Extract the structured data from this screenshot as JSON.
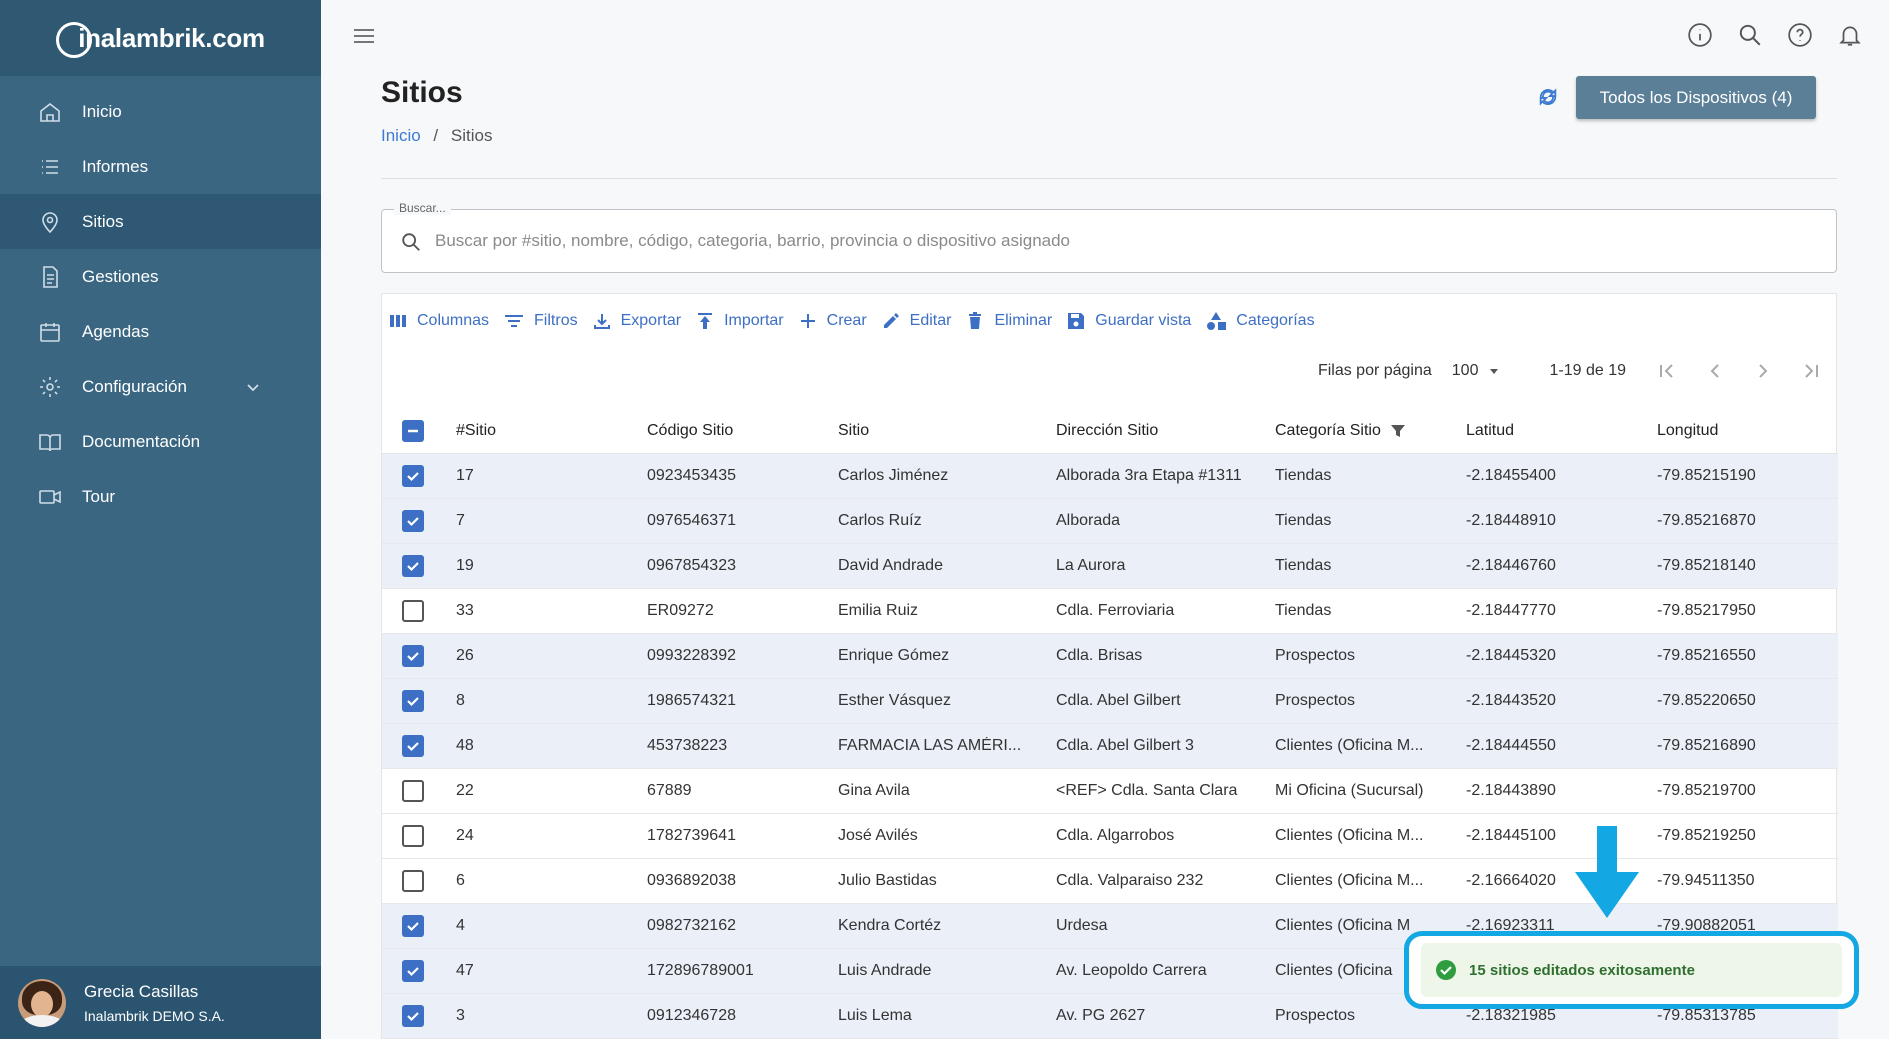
{
  "app": {
    "logo_text": "alambrik.com",
    "logo_prefix": "in"
  },
  "sidebar": {
    "items": [
      {
        "label": "Inicio",
        "icon": "home-icon"
      },
      {
        "label": "Informes",
        "icon": "list-icon"
      },
      {
        "label": "Sitios",
        "icon": "location-pin-icon",
        "active": true
      },
      {
        "label": "Gestiones",
        "icon": "document-icon"
      },
      {
        "label": "Agendas",
        "icon": "calendar-icon"
      },
      {
        "label": "Configuración",
        "icon": "gear-icon"
      },
      {
        "label": "Documentación",
        "icon": "book-icon"
      },
      {
        "label": "Tour",
        "icon": "video-camera-icon"
      }
    ],
    "user": {
      "name": "Grecia Casillas",
      "org": "Inalambrik DEMO S.A."
    }
  },
  "header": {
    "title": "Sitios",
    "breadcrumb": {
      "home": "Inicio",
      "sep": "/",
      "current": "Sitios"
    },
    "devices_button": "Todos los Dispositivos (4)"
  },
  "search": {
    "label": "Buscar...",
    "placeholder": "Buscar por #sitio, nombre, código, categoria, barrio, provincia o dispositivo asignado",
    "value": ""
  },
  "toolbar": {
    "columns": "Columnas",
    "filters": "Filtros",
    "export": "Exportar",
    "import": "Importar",
    "create": "Crear",
    "edit": "Editar",
    "delete": "Eliminar",
    "save_view": "Guardar vista",
    "categories": "Categorías"
  },
  "pager": {
    "rows_label": "Filas por página",
    "rows_value": "100",
    "range": "1-19 de 19"
  },
  "table": {
    "headers": [
      "#Sitio",
      "Código Sitio",
      "Sitio",
      "Dirección Sitio",
      "Categoría Sitio",
      "Latitud",
      "Longitud"
    ],
    "rows": [
      {
        "checked": true,
        "cells": [
          "17",
          "0923453435",
          "Carlos Jiménez",
          "Alborada 3ra Etapa #1311",
          "Tiendas",
          "-2.18455400",
          "-79.85215190"
        ]
      },
      {
        "checked": true,
        "cells": [
          "7",
          "0976546371",
          "Carlos Ruíz",
          "Alborada",
          "Tiendas",
          "-2.18448910",
          "-79.85216870"
        ]
      },
      {
        "checked": true,
        "cells": [
          "19",
          "0967854323",
          "David Andrade",
          "La Aurora",
          "Tiendas",
          "-2.18446760",
          "-79.85218140"
        ]
      },
      {
        "checked": false,
        "cells": [
          "33",
          "ER09272",
          "Emilia Ruiz",
          "Cdla. Ferroviaria",
          "Tiendas",
          "-2.18447770",
          "-79.85217950"
        ]
      },
      {
        "checked": true,
        "cells": [
          "26",
          "0993228392",
          "Enrique Gómez",
          "Cdla. Brisas",
          "Prospectos",
          "-2.18445320",
          "-79.85216550"
        ]
      },
      {
        "checked": true,
        "cells": [
          "8",
          "1986574321",
          "Esther Vásquez",
          "Cdla. Abel Gilbert",
          "Prospectos",
          "-2.18443520",
          "-79.85220650"
        ]
      },
      {
        "checked": true,
        "cells": [
          "48",
          "453738223",
          "FARMACIA LAS AMÉRI...",
          "Cdla. Abel Gilbert 3",
          "Clientes (Oficina M...",
          "-2.18444550",
          "-79.85216890"
        ]
      },
      {
        "checked": false,
        "cells": [
          "22",
          "67889",
          "Gina Avila",
          "<REF> Cdla. Santa Clara",
          "Mi Oficina (Sucursal)",
          "-2.18443890",
          "-79.85219700"
        ]
      },
      {
        "checked": false,
        "cells": [
          "24",
          "1782739641",
          "José Avilés",
          "Cdla. Algarrobos",
          "Clientes (Oficina M...",
          "-2.18445100",
          "-79.85219250"
        ]
      },
      {
        "checked": false,
        "cells": [
          "6",
          "0936892038",
          "Julio Bastidas",
          "Cdla. Valparaiso 232",
          "Clientes (Oficina M...",
          "-2.16664020",
          "-79.94511350"
        ]
      },
      {
        "checked": true,
        "cells": [
          "4",
          "0982732162",
          "Kendra Cortéz",
          "Urdesa",
          "Clientes (Oficina M",
          "-2.16923311",
          "-79.90882051"
        ]
      },
      {
        "checked": true,
        "cells": [
          "47",
          "172896789001",
          "Luis Andrade",
          "Av. Leopoldo Carrera",
          "Clientes (Oficina",
          "",
          ""
        ]
      },
      {
        "checked": true,
        "cells": [
          "3",
          "0912346728",
          "Luis Lema",
          "Av. PG 2627",
          "Prospectos",
          "-2.18321985",
          "-79.85313785"
        ]
      }
    ]
  },
  "toast": {
    "message": "15 sitios editados exitosamente"
  },
  "colors": {
    "sidebar": "#3a6682",
    "accent": "#3d6fc4",
    "highlight": "#13a7e3",
    "success": "#2e9c3f"
  }
}
